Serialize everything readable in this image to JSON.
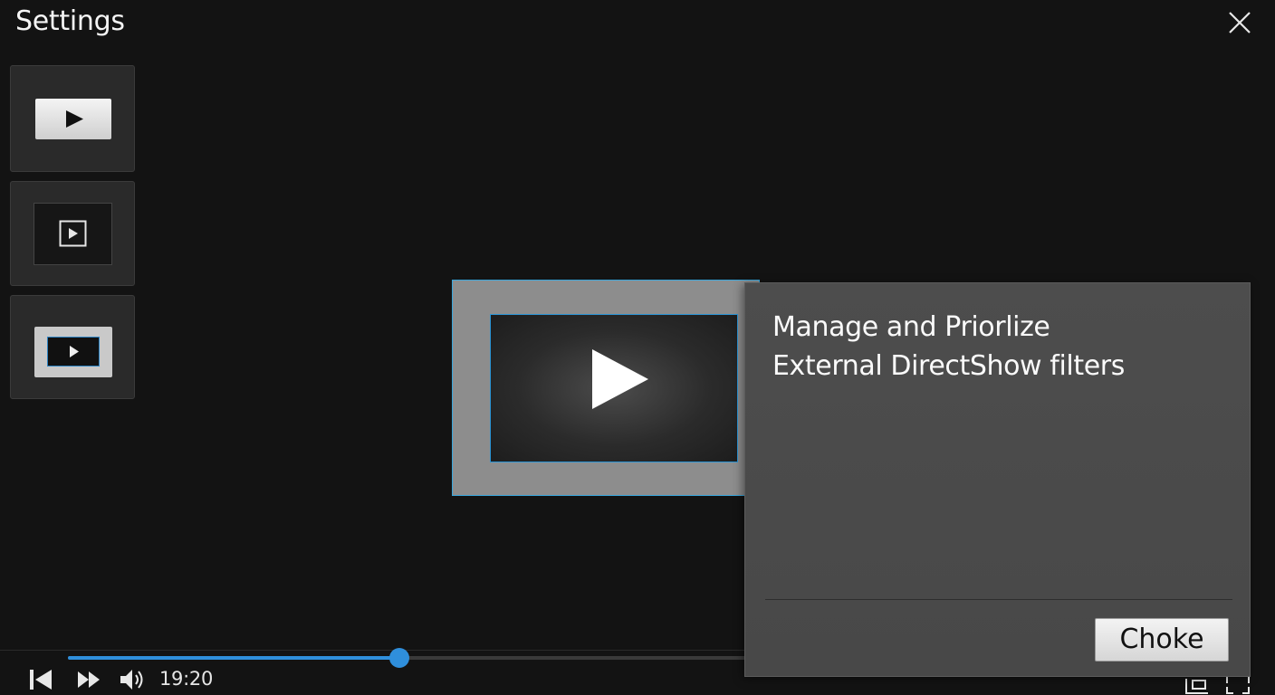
{
  "window": {
    "title": "Settings"
  },
  "sidebar": {
    "items": [
      {
        "name": "thumb-play-light",
        "icon": "play-icon"
      },
      {
        "name": "thumb-play-framed",
        "icon": "play-square-icon"
      },
      {
        "name": "thumb-play-blue",
        "icon": "play-icon"
      }
    ]
  },
  "playback": {
    "time": "19:20",
    "progress_fraction": 0.481
  },
  "dialog": {
    "message_line1": "Manage and Priorlize",
    "message_line2": "External DirectShow filters",
    "button_label": "Choke"
  },
  "colors": {
    "accent": "#2f8fdc",
    "background": "#131313",
    "dialog": "#4b4b4b"
  }
}
